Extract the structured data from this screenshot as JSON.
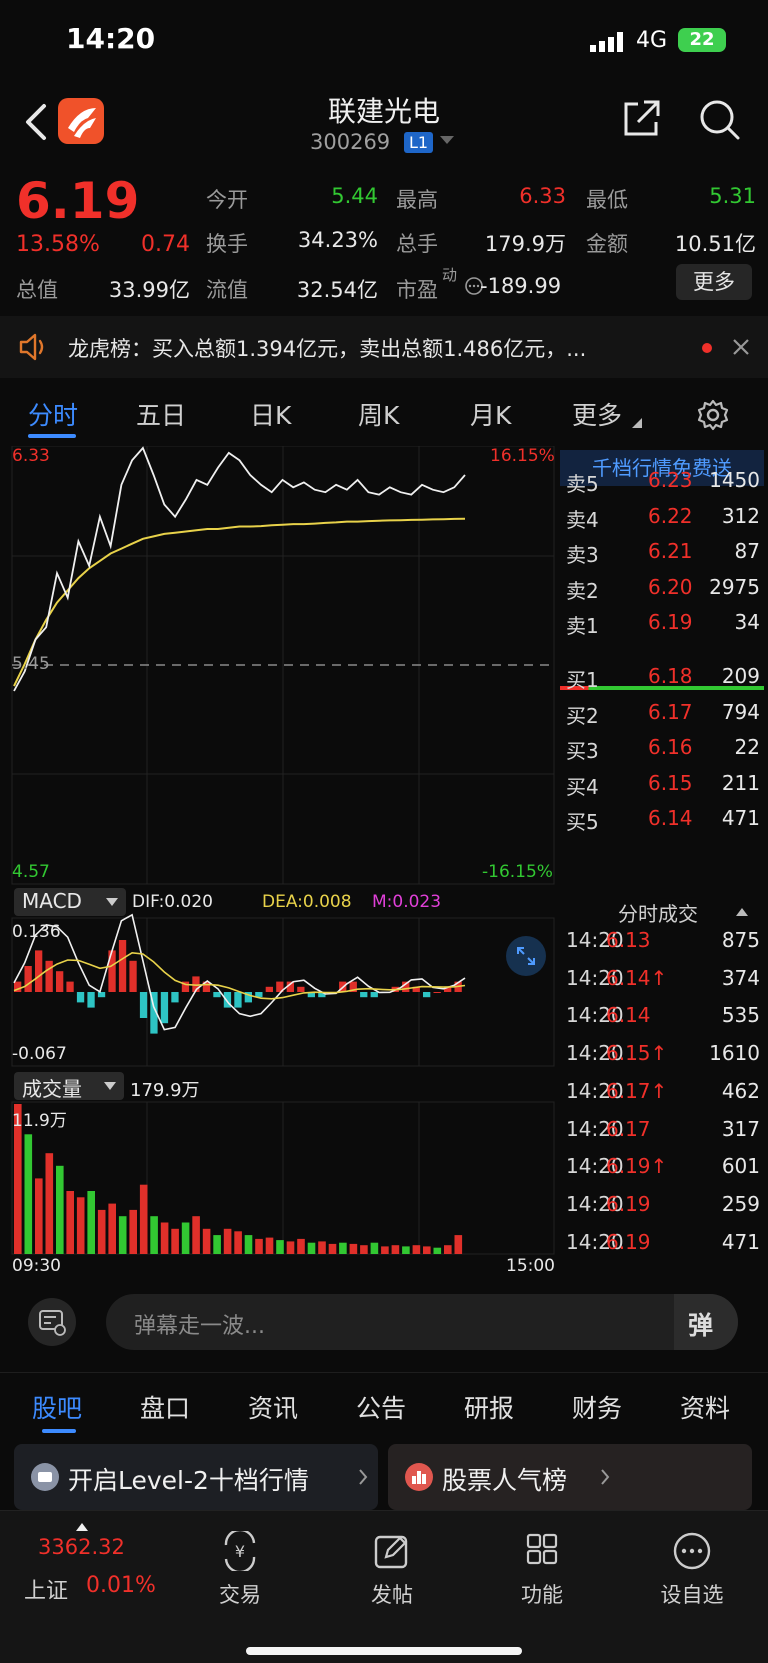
{
  "status_bar": {
    "time": "14:20",
    "network": "4G",
    "battery": "22"
  },
  "header": {
    "name": "联建光电",
    "code": "300269",
    "level_badge": "L1"
  },
  "quote": {
    "price": "6.19",
    "change_pct": "13.58%",
    "change": "0.74",
    "open_label": "今开",
    "open": "5.44",
    "high_label": "最高",
    "high": "6.33",
    "low_label": "最低",
    "low": "5.31",
    "turnover_label": "换手",
    "turnover": "34.23%",
    "total_vol_label": "总手",
    "total_vol": "179.9万",
    "amount_label": "金额",
    "amount": "10.51亿",
    "mcap_label": "总值",
    "mcap": "33.99亿",
    "float_label": "流值",
    "float_val": "32.54亿",
    "pe_label": "市盈",
    "pe_sup": "动",
    "pe": "-189.99",
    "more_label": "更多"
  },
  "notice": {
    "text": "龙虎榜：买入总额1.394亿元，卖出总额1.486亿元，..."
  },
  "chart_tabs": [
    "分时",
    "五日",
    "日K",
    "周K",
    "月K",
    "更多"
  ],
  "chart_data": [
    {
      "type": "line",
      "title": "",
      "series": [
        {
          "name": "price"
        },
        {
          "name": "average"
        }
      ],
      "x": [
        "09:30",
        "15:00"
      ],
      "y_left": {
        "top": "6.33",
        "prev_close": "5.45",
        "bottom": "4.57"
      },
      "y_right": {
        "top": "16.15%",
        "bottom": "-16.15%"
      },
      "price_path": [
        5.34,
        5.42,
        5.55,
        5.6,
        5.82,
        5.72,
        5.95,
        5.85,
        6.05,
        5.93,
        6.18,
        6.28,
        6.33,
        6.22,
        6.1,
        6.05,
        6.12,
        6.2,
        6.18,
        6.25,
        6.31,
        6.28,
        6.22,
        6.18,
        6.15,
        6.2,
        6.17,
        6.19,
        6.16,
        6.15,
        6.18,
        6.16,
        6.2,
        6.15,
        6.14,
        6.17,
        6.15,
        6.14,
        6.18,
        6.16,
        6.15,
        6.17,
        6.22
      ],
      "avg_path": [
        5.36,
        5.45,
        5.55,
        5.63,
        5.7,
        5.75,
        5.8,
        5.84,
        5.87,
        5.9,
        5.92,
        5.94,
        5.96,
        5.97,
        5.98,
        5.985,
        5.99,
        5.995,
        6.0,
        6.0,
        6.005,
        6.01,
        6.01,
        6.012,
        6.015,
        6.017,
        6.02,
        6.02,
        6.022,
        6.025,
        6.027,
        6.03,
        6.03,
        6.032,
        6.034,
        6.035,
        6.036,
        6.037,
        6.038,
        6.039,
        6.04,
        6.041,
        6.042
      ]
    },
    {
      "type": "line",
      "title": "MACD",
      "dif": "DIF:0.020",
      "dea": "DEA:0.008",
      "m": "M:0.023",
      "ylim_labels": [
        "0.136",
        "-0.067"
      ],
      "macd_hist": [
        0.02,
        0.05,
        0.08,
        0.06,
        0.04,
        0.02,
        -0.02,
        -0.03,
        -0.01,
        0.08,
        0.1,
        0.06,
        -0.05,
        -0.08,
        -0.06,
        -0.02,
        0.02,
        0.03,
        0.02,
        -0.01,
        -0.03,
        -0.03,
        -0.02,
        -0.01,
        0.01,
        0.02,
        0.02,
        0.01,
        -0.01,
        -0.01,
        0.0,
        0.02,
        0.02,
        -0.01,
        -0.01,
        0.0,
        0.01,
        0.02,
        0.01,
        -0.01,
        0.0,
        0.01,
        0.02
      ]
    },
    {
      "type": "bar",
      "title": "成交量",
      "total": "179.9万",
      "ymax_label": "11.9万",
      "volumes": [
        11.9,
        9.5,
        6,
        8,
        7,
        5,
        4.5,
        5,
        3.5,
        4,
        3,
        3.5,
        5.5,
        3,
        2.5,
        2,
        2.5,
        3,
        2,
        1.5,
        2,
        1.8,
        1.5,
        1.2,
        1.3,
        1.1,
        1,
        1.2,
        0.9,
        1,
        0.8,
        0.9,
        0.8,
        0.7,
        0.9,
        0.6,
        0.7,
        0.6,
        0.7,
        0.6,
        0.5,
        0.7,
        1.5
      ]
    }
  ],
  "orderbook": {
    "header": "千档行情免费送",
    "asks": [
      {
        "label": "卖5",
        "price": "6.23",
        "vol": "1450"
      },
      {
        "label": "卖4",
        "price": "6.22",
        "vol": "312"
      },
      {
        "label": "卖3",
        "price": "6.21",
        "vol": "87"
      },
      {
        "label": "卖2",
        "price": "6.20",
        "vol": "2975"
      },
      {
        "label": "卖1",
        "price": "6.19",
        "vol": "34"
      }
    ],
    "bids": [
      {
        "label": "买1",
        "price": "6.18",
        "vol": "209"
      },
      {
        "label": "买2",
        "price": "6.17",
        "vol": "794"
      },
      {
        "label": "买3",
        "price": "6.16",
        "vol": "22"
      },
      {
        "label": "买4",
        "price": "6.15",
        "vol": "211"
      },
      {
        "label": "买5",
        "price": "6.14",
        "vol": "471"
      }
    ],
    "trades_title": "分时成交",
    "trades": [
      {
        "time": "14:20",
        "price": "6.13",
        "vol": "875"
      },
      {
        "time": "14:20",
        "price": "6.14↑",
        "vol": "374"
      },
      {
        "time": "14:20",
        "price": "6.14",
        "vol": "535"
      },
      {
        "time": "14:20",
        "price": "6.15↑",
        "vol": "1610"
      },
      {
        "time": "14:20",
        "price": "6.17↑",
        "vol": "462"
      },
      {
        "time": "14:20",
        "price": "6.17",
        "vol": "317"
      },
      {
        "time": "14:20",
        "price": "6.19↑",
        "vol": "601"
      },
      {
        "time": "14:20",
        "price": "6.19",
        "vol": "259"
      },
      {
        "time": "14:20",
        "price": "6.19",
        "vol": "471"
      }
    ]
  },
  "danmu": {
    "placeholder": "弹幕走一波...",
    "send_icon": "弹"
  },
  "info_tabs": [
    "股吧",
    "盘口",
    "资讯",
    "公告",
    "研报",
    "财务",
    "资料"
  ],
  "promo": {
    "left": "开启Level-2十档行情",
    "right": "股票人气榜"
  },
  "bottom_nav": {
    "index_value": "3362.32",
    "index_name": "上证",
    "index_change": "0.01%",
    "items": [
      "交易",
      "发帖",
      "功能",
      "设自选"
    ]
  },
  "colors": {
    "up": "#f0302a",
    "down": "#32c832",
    "accent": "#3d8bff"
  }
}
